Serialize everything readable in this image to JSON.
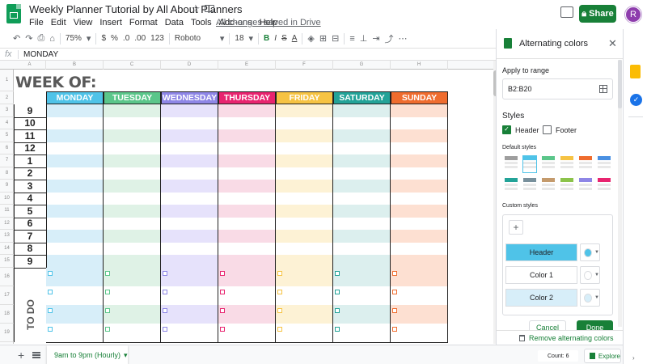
{
  "app": {
    "doc_title": "Weekly Planner Tutorial by All About Planners",
    "saved_status": "All changes saved in Drive",
    "menu": [
      "File",
      "Edit",
      "View",
      "Insert",
      "Format",
      "Data",
      "Tools",
      "Add-ons",
      "Help"
    ],
    "share_label": "Share",
    "avatar_initial": "R"
  },
  "toolbar": {
    "zoom": "75%",
    "currency": "$",
    "percent": "%",
    "decimals_less": ".0",
    "decimals_more": ".00",
    "format_more": "123",
    "font": "Roboto",
    "font_size": "18",
    "bold": "B",
    "italic": "I",
    "strike": "S",
    "text_color": "A"
  },
  "formula": {
    "fx": "fx",
    "value": "MONDAY"
  },
  "sheet": {
    "columns": [
      "A",
      "B",
      "C",
      "D",
      "E",
      "F",
      "G",
      "H"
    ],
    "rows": [
      "1",
      "2",
      "3",
      "4",
      "5",
      "6",
      "7",
      "8",
      "9",
      "10",
      "11",
      "12",
      "13",
      "14",
      "15",
      "16",
      "17",
      "18",
      "19"
    ],
    "week_of": "WEEK OF:",
    "days": [
      {
        "label": "MONDAY",
        "head": "#4fc3e8",
        "light": "#d7eef9"
      },
      {
        "label": "TUESDAY",
        "head": "#5bc68a",
        "light": "#dff2e6"
      },
      {
        "label": "WEDNESDAY",
        "head": "#8e86e6",
        "light": "#e6e2fb"
      },
      {
        "label": "THURSDAY",
        "head": "#e8246f",
        "light": "#f9dbe6"
      },
      {
        "label": "FRIDAY",
        "head": "#f6c343",
        "light": "#fdf2d5"
      },
      {
        "label": "SATURDAY",
        "head": "#23a398",
        "light": "#dcefee"
      },
      {
        "label": "SUNDAY",
        "head": "#ef6c2e",
        "light": "#fde0d2"
      }
    ],
    "hours": [
      "9",
      "10",
      "11",
      "12",
      "1",
      "2",
      "3",
      "4",
      "5",
      "6",
      "7",
      "8",
      "9"
    ],
    "todo_label": "TO DO"
  },
  "panel": {
    "title": "Alternating colors",
    "apply_label": "Apply to range",
    "range": "B2:B20",
    "styles_label": "Styles",
    "header_label": "Header",
    "footer_label": "Footer",
    "default_styles_label": "Default styles",
    "swatches": [
      "#9e9e9e",
      "#4fc3e8",
      "#5bc68a",
      "#f6c343",
      "#ef6c2e",
      "#4a90e2",
      "#23a398",
      "#78909c",
      "#c49a6c",
      "#8bc34a",
      "#8e86e6",
      "#e8246f"
    ],
    "custom_styles_label": "Custom styles",
    "add_label": "+",
    "custom_rows": [
      {
        "label": "Header",
        "color": "#4fc3e8"
      },
      {
        "label": "Color 1",
        "color": "#ffffff"
      },
      {
        "label": "Color 2",
        "color": "#d7eef9"
      }
    ],
    "cancel_label": "Cancel",
    "done_label": "Done",
    "remove_label": "Remove alternating colors"
  },
  "bottom": {
    "add_sheet": "+",
    "tab_label": "9am to 9pm (Hourly)",
    "count": "Count: 6",
    "explore": "Explore"
  }
}
